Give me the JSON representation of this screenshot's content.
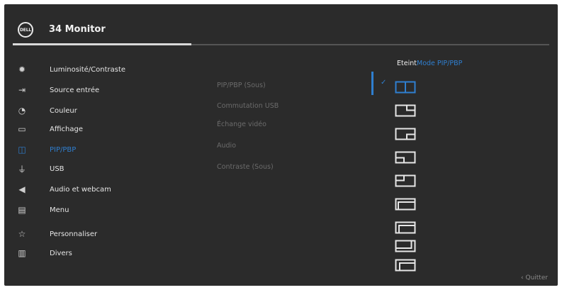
{
  "header": {
    "title": "34 Monitor",
    "logo_text": "DELL"
  },
  "menu": [
    {
      "label": "Luminosité/Contraste",
      "icon": "brightness-icon"
    },
    {
      "label": "Source entrée",
      "icon": "input-source-icon"
    },
    {
      "label": "Couleur",
      "icon": "color-icon"
    },
    {
      "label": "Affichage",
      "icon": "display-icon"
    },
    {
      "label": "PIP/PBP",
      "icon": "pip-pbp-icon",
      "active": true
    },
    {
      "label": "USB",
      "icon": "usb-icon"
    },
    {
      "label": "Audio et webcam",
      "icon": "speaker-icon"
    },
    {
      "label": "Menu",
      "icon": "menu-icon"
    },
    {
      "label": "Personnaliser",
      "icon": "star-icon"
    },
    {
      "label": "Divers",
      "icon": "others-icon"
    }
  ],
  "submenu": [
    {
      "label": "PIP/PBP (Sous)"
    },
    {
      "label": "Commutation USB"
    },
    {
      "label": "Échange vidéo"
    },
    {
      "label": "Audio"
    },
    {
      "label": "Contraste (Sous)"
    }
  ],
  "mode_panel": {
    "off_label": "Eteint",
    "mode_label": "Mode PIP/PBP",
    "check": "✓",
    "layouts": [
      "pbp-split-icon",
      "pip-top-right-icon",
      "pip-bottom-right-icon",
      "pip-bottom-left-icon",
      "pip-top-left-icon",
      "pbp-top-bottom-icon",
      "pbp-left-right-icon",
      "pbp-right-large-icon",
      "pbp-bottom-right-large-icon"
    ]
  },
  "footer": {
    "exit_label": "Quitter",
    "exit_arrow": "‹"
  },
  "colors": {
    "background": "#2b2b2b",
    "accent": "#2f7fd0",
    "text": "#e6e6e6",
    "disabled": "#6b6b6b"
  }
}
